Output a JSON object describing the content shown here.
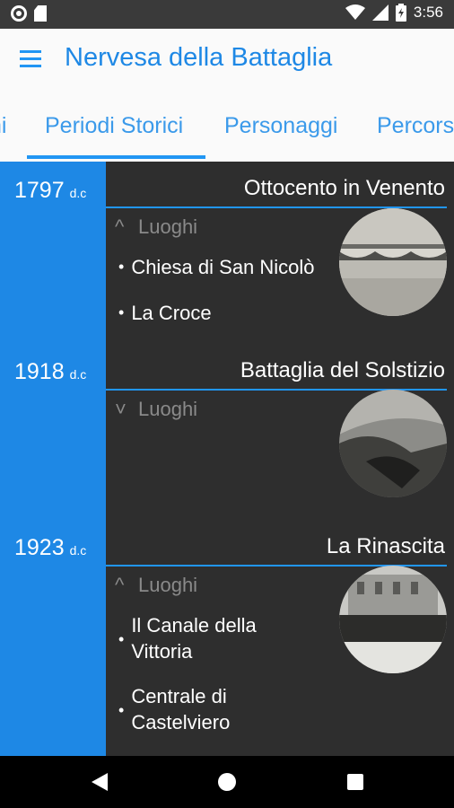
{
  "status_bar": {
    "time": "3:56",
    "left_icons": [
      "notification-ring-icon",
      "sd-card-icon"
    ],
    "right_icons": [
      "wifi-icon",
      "cell-signal-icon",
      "battery-icon"
    ]
  },
  "app_bar": {
    "title": "Nervesa della Battaglia",
    "menu_icon": "hamburger-menu-icon",
    "accent": "#1e88e5"
  },
  "tabs": [
    {
      "label": "ni",
      "selected": false
    },
    {
      "label": "Periodi Storici",
      "selected": true
    },
    {
      "label": "Personaggi",
      "selected": false
    },
    {
      "label": "Percors",
      "selected": false
    }
  ],
  "timeline": {
    "rail_color": "#1e88e5",
    "periods": [
      {
        "year": "1797",
        "era": "d.c",
        "title": "Ottocento in Venento",
        "section_label": "Luoghi",
        "expanded": true,
        "chevron": "chevron-up-icon",
        "places": [
          "Chiesa di San Nicolò",
          "La Croce"
        ],
        "thumb_icon": "bridge-photo-icon"
      },
      {
        "year": "1918",
        "era": "d.c",
        "title": "Battaglia del Solstizio",
        "section_label": "Luoghi",
        "expanded": false,
        "chevron": "chevron-down-icon",
        "places": [],
        "thumb_icon": "battlefield-photo-icon"
      },
      {
        "year": "1923",
        "era": "d.c",
        "title": "La Rinascita",
        "section_label": "Luoghi",
        "expanded": true,
        "chevron": "chevron-up-icon",
        "places": [
          "Il Canale della Vittoria",
          "Centrale di Castelviero"
        ],
        "thumb_icon": "crowd-photo-icon"
      }
    ]
  },
  "nav_bar": {
    "icons": [
      "back-icon",
      "home-icon",
      "recents-icon"
    ]
  }
}
